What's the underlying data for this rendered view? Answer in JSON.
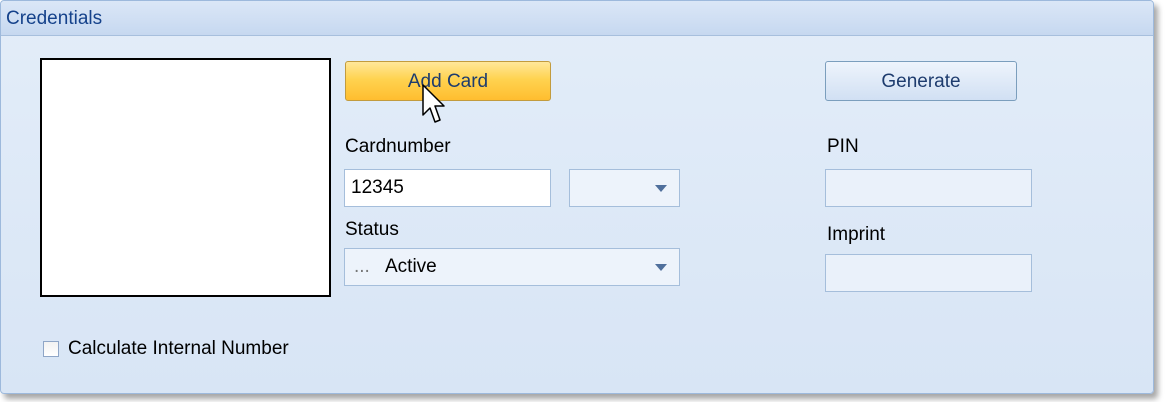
{
  "panel": {
    "title": "Credentials"
  },
  "buttons": {
    "add_card": "Add Card",
    "generate": "Generate"
  },
  "fields": {
    "cardnumber_label": "Cardnumber",
    "cardnumber_value": "12345",
    "cardnumber_type_value": "",
    "status_label": "Status",
    "status_prefix": "...",
    "status_value": "Active",
    "pin_label": "PIN",
    "pin_value": "",
    "imprint_label": "Imprint",
    "imprint_value": ""
  },
  "options": {
    "calc_internal_label": "Calculate Internal Number",
    "calc_internal_checked": false
  },
  "icons": {
    "cursor": "mouse-pointer-icon",
    "dropdown": "chevron-down-icon"
  }
}
